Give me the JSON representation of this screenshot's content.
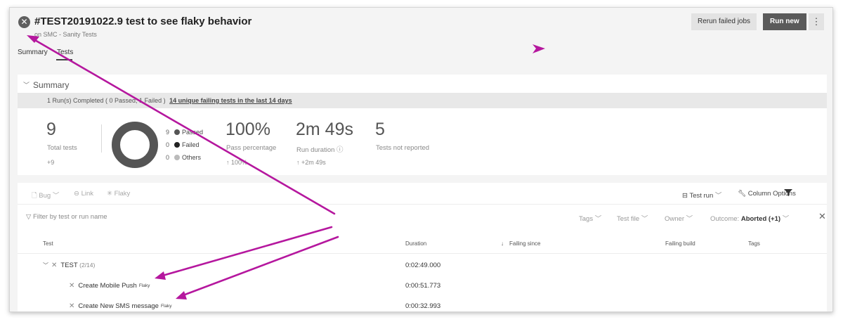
{
  "header": {
    "title": "#TEST20191022.9 test to see flaky behavior",
    "subtitle": "on SMC - Sanity Tests",
    "rerun_label": "Rerun failed jobs",
    "run_new_label": "Run new",
    "more_label": "⋮",
    "status_glyph": "✕"
  },
  "tabs": [
    {
      "label": "Summary"
    },
    {
      "label": "Tests"
    }
  ],
  "summary": {
    "heading": "Summary",
    "banner_text": "1 Run(s) Completed ( 0 Passed, 1 Failed )",
    "banner_link": "14 unique failing tests in the last 14 days",
    "total_tests": "9",
    "total_label": "Total tests",
    "total_delta": "+9",
    "donut": {
      "passed": 9,
      "failed": 0,
      "others": 0,
      "passed_label": "Passed",
      "failed_label": "Failed",
      "others_label": "Others",
      "passed_color": "#555555",
      "failed_color": "#222222",
      "others_color": "#bbbbbb"
    },
    "pass_pct": "100%",
    "pass_label": "Pass percentage",
    "pass_delta": "↑ 100%",
    "duration": "2m 49s",
    "duration_label": "Run duration ⓘ",
    "duration_delta": "↑ +2m 49s",
    "not_reported": "5",
    "not_reported_label": "Tests not reported"
  },
  "toolbar": {
    "bug_label": "Bug",
    "link_label": "Link",
    "flaky_label": "Flaky",
    "test_run_label": "Test run",
    "column_options_label": "Column Options"
  },
  "filter": {
    "placeholder": "Filter by test or run name",
    "tags_label": "Tags",
    "test_file_label": "Test file",
    "owner_label": "Owner",
    "outcome_prefix": "Outcome:",
    "outcome_value": "Aborted (+1)"
  },
  "columns": {
    "test": "Test",
    "duration": "Duration",
    "failing_since": "Failing since",
    "failing_build": "Failing build",
    "tags": "Tags"
  },
  "rows": [
    {
      "name": "TEST",
      "count": "(2/14)",
      "duration": "0:02:49.000",
      "flaky": ""
    },
    {
      "name": "Create Mobile Push",
      "count": "",
      "duration": "0:00:51.773",
      "flaky": "Flaky"
    },
    {
      "name": "Create New SMS message",
      "count": "",
      "duration": "0:00:32.993",
      "flaky": "Flaky"
    }
  ],
  "annotation_color": "#b5179e"
}
